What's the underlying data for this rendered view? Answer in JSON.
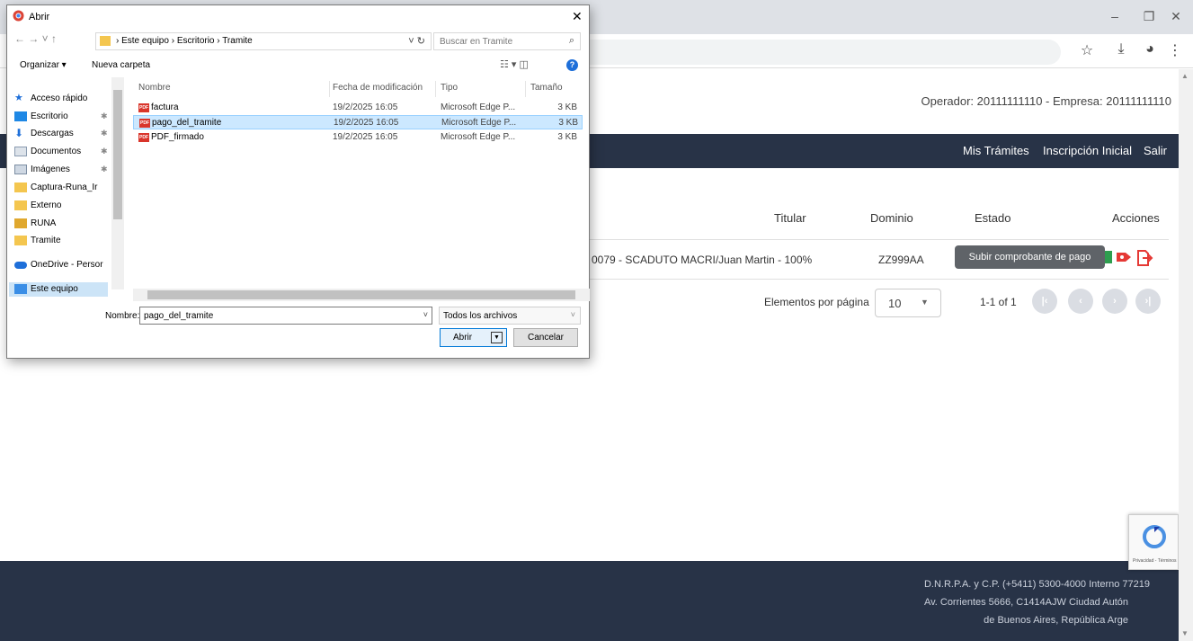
{
  "dialog": {
    "title": "Abrir",
    "path": "› Este equipo › Escritorio › Tramite",
    "search_placeholder": "Buscar en Tramite",
    "organize_label": "Organizar ▾",
    "new_folder_label": "Nueva carpeta",
    "nav_items": [
      {
        "label": "Acceso rápido"
      },
      {
        "label": "Escritorio"
      },
      {
        "label": "Descargas"
      },
      {
        "label": "Documentos"
      },
      {
        "label": "Imágenes"
      },
      {
        "label": "Captura-Runa_Ir"
      },
      {
        "label": "Externo"
      },
      {
        "label": "RUNA"
      },
      {
        "label": "Tramite"
      },
      {
        "label": "OneDrive - Persor"
      },
      {
        "label": "Este equipo"
      }
    ],
    "columns": {
      "name": "Nombre",
      "modified": "Fecha de modificación",
      "type": "Tipo",
      "size": "Tamaño"
    },
    "files": [
      {
        "name": "factura",
        "modified": "19/2/2025 16:05",
        "type": "Microsoft Edge P...",
        "size": "3 KB"
      },
      {
        "name": "pago_del_tramite",
        "modified": "19/2/2025 16:05",
        "type": "Microsoft Edge P...",
        "size": "3 KB"
      },
      {
        "name": "PDF_firmado",
        "modified": "19/2/2025 16:05",
        "type": "Microsoft Edge P...",
        "size": "3 KB"
      }
    ],
    "filename_label": "Nombre:",
    "filename_value": "pago_del_tramite",
    "filter_value": "Todos los archivos",
    "open_label": "Abrir",
    "cancel_label": "Cancelar"
  },
  "page": {
    "operator_text": "Operador: 20111111110 - Empresa: 20111111110",
    "nav": {
      "mis_tramites": "Mis Trámites",
      "inscripcion": "Inscripción Inicial",
      "salir": "Salir"
    },
    "table": {
      "headers": {
        "titular": "Titular",
        "dominio": "Dominio",
        "estado": "Estado",
        "acciones": "Acciones"
      },
      "row": {
        "titular": "0079 - SCADUTO MACRI/Juan Martin - 100%",
        "dominio": "ZZ999AA"
      },
      "tooltip": "Subir comprobante de pago"
    },
    "paginator": {
      "label": "Elementos por página",
      "page_size": "10",
      "range": "1-1 of 1"
    },
    "footer": {
      "line1": "D.N.R.P.A. y C.P. (+5411) 5300-4000 Interno 77219",
      "line2": "Av. Corrientes 5666, C1414AJW Ciudad Autón",
      "line3": "de Buenos Aires, República Arge"
    },
    "recaptcha_text": "Privacidad - Términos"
  },
  "colors": {
    "navbar": "#283347",
    "accent_icon": "#e53935",
    "selection": "#cce8ff"
  }
}
